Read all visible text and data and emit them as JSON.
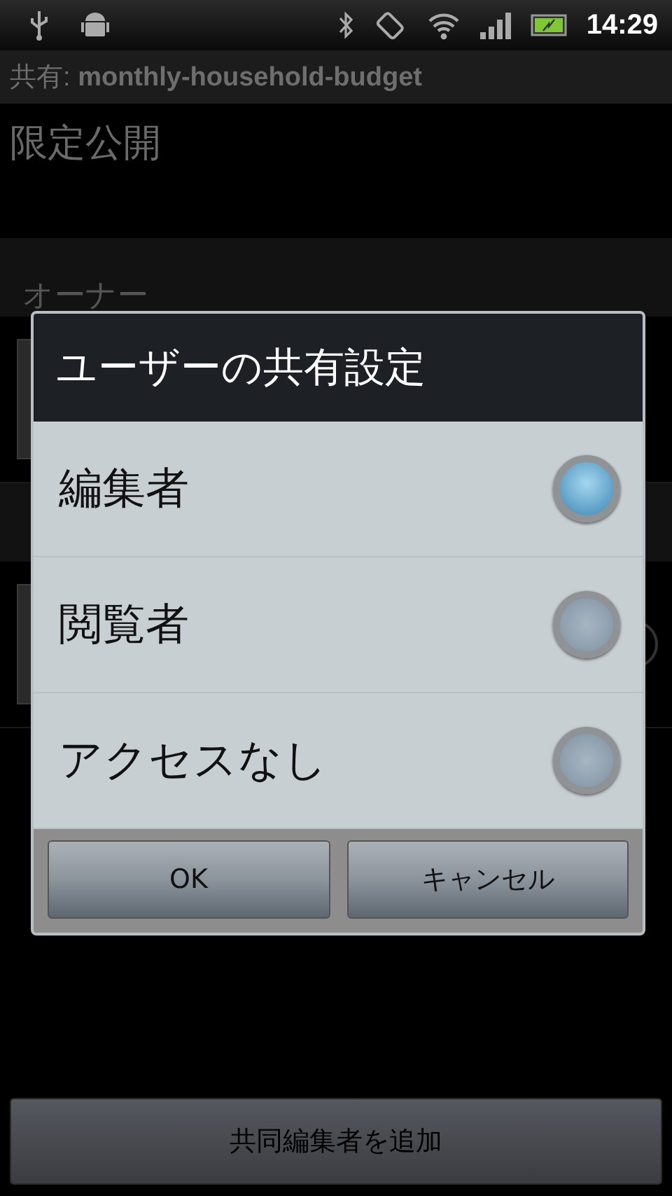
{
  "status_bar": {
    "time": "14:29"
  },
  "title_bar": {
    "title": "共有: **monthly-household-budget**"
  },
  "visibility": "限定公開",
  "owner_header": "オーナー",
  "add_button": "共同編集者を追加",
  "dialog": {
    "title": "ユーザーの共有設定",
    "options": [
      {
        "label": "編集者",
        "selected": true
      },
      {
        "label": "閲覧者",
        "selected": false
      },
      {
        "label": "アクセスなし",
        "selected": false
      }
    ],
    "buttons": [
      "OK",
      "キャンセル"
    ]
  }
}
